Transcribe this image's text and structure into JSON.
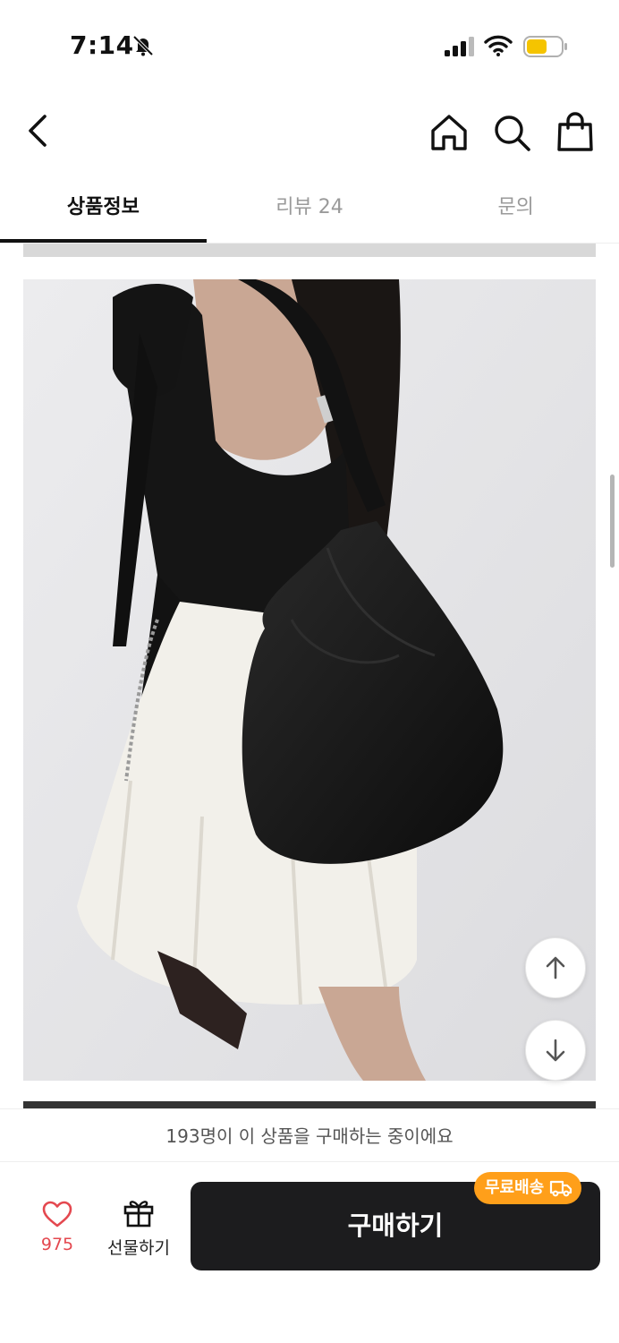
{
  "status_bar": {
    "time": "7:14",
    "battery_color": "#f5c400"
  },
  "header": {
    "icons": [
      "back-arrow-icon",
      "home-icon",
      "search-icon",
      "shopping-bag-icon"
    ]
  },
  "tabs": [
    {
      "label": "상품정보",
      "active": true
    },
    {
      "label": "리뷰 24",
      "active": false
    },
    {
      "label": "문의",
      "active": false
    }
  ],
  "content": {
    "image_alt": "product photo: black nylon shoulder hobo bag worn over black top and white skirt"
  },
  "floating_buttons": {
    "up_icon": "arrow-up-icon",
    "down_icon": "arrow-down-icon"
  },
  "bottom": {
    "buying_banner": "193명이 이 상품을 구매하는 중이에요",
    "like_count": "975",
    "gift_label": "선물하기",
    "buy_label": "구매하기",
    "free_shipping_badge": "무료배송",
    "accent_color": "#ff9f1a",
    "like_color": "#e4484f"
  }
}
